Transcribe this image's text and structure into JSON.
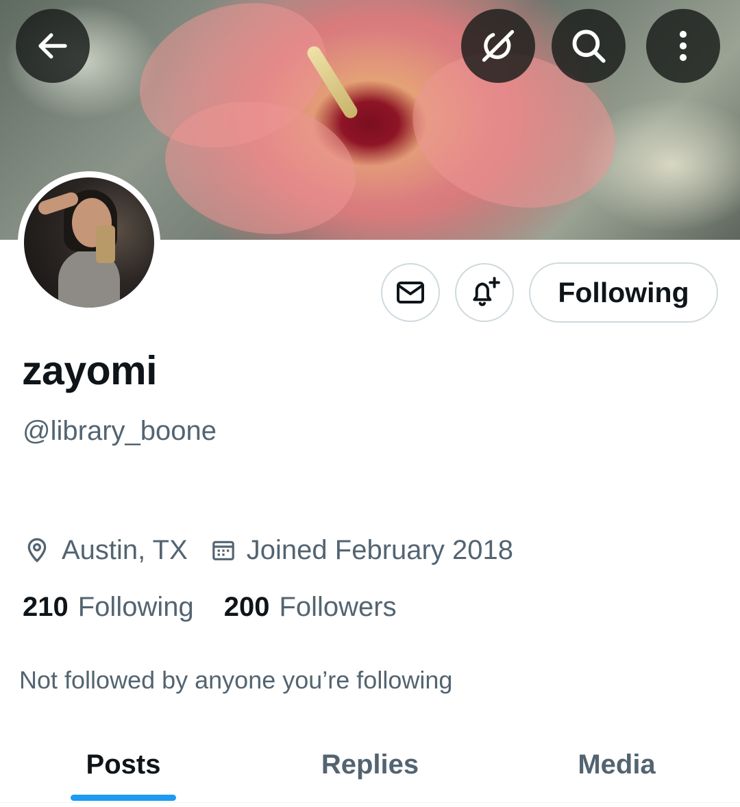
{
  "header": {
    "back_icon": "arrow-left-icon",
    "icons": [
      "grok-icon",
      "search-icon",
      "more-vertical-icon"
    ]
  },
  "profile": {
    "display_name": "zayomi",
    "handle": "@library_boone",
    "location": "Austin, TX",
    "joined": "Joined February 2018",
    "following_count": "210",
    "following_label": "Following",
    "followers_count": "200",
    "followers_label": "Followers",
    "followed_by_text": "Not followed by anyone you’re following"
  },
  "actions": {
    "message_icon": "envelope-icon",
    "notify_icon": "bell-plus-icon",
    "follow_label": "Following"
  },
  "tabs": [
    {
      "label": "Posts",
      "active": true
    },
    {
      "label": "Replies",
      "active": false
    },
    {
      "label": "Media",
      "active": false
    }
  ],
  "colors": {
    "accent": "#1d9bf0",
    "text_primary": "#0f1419",
    "text_secondary": "#536471",
    "border": "#cfd9de"
  }
}
